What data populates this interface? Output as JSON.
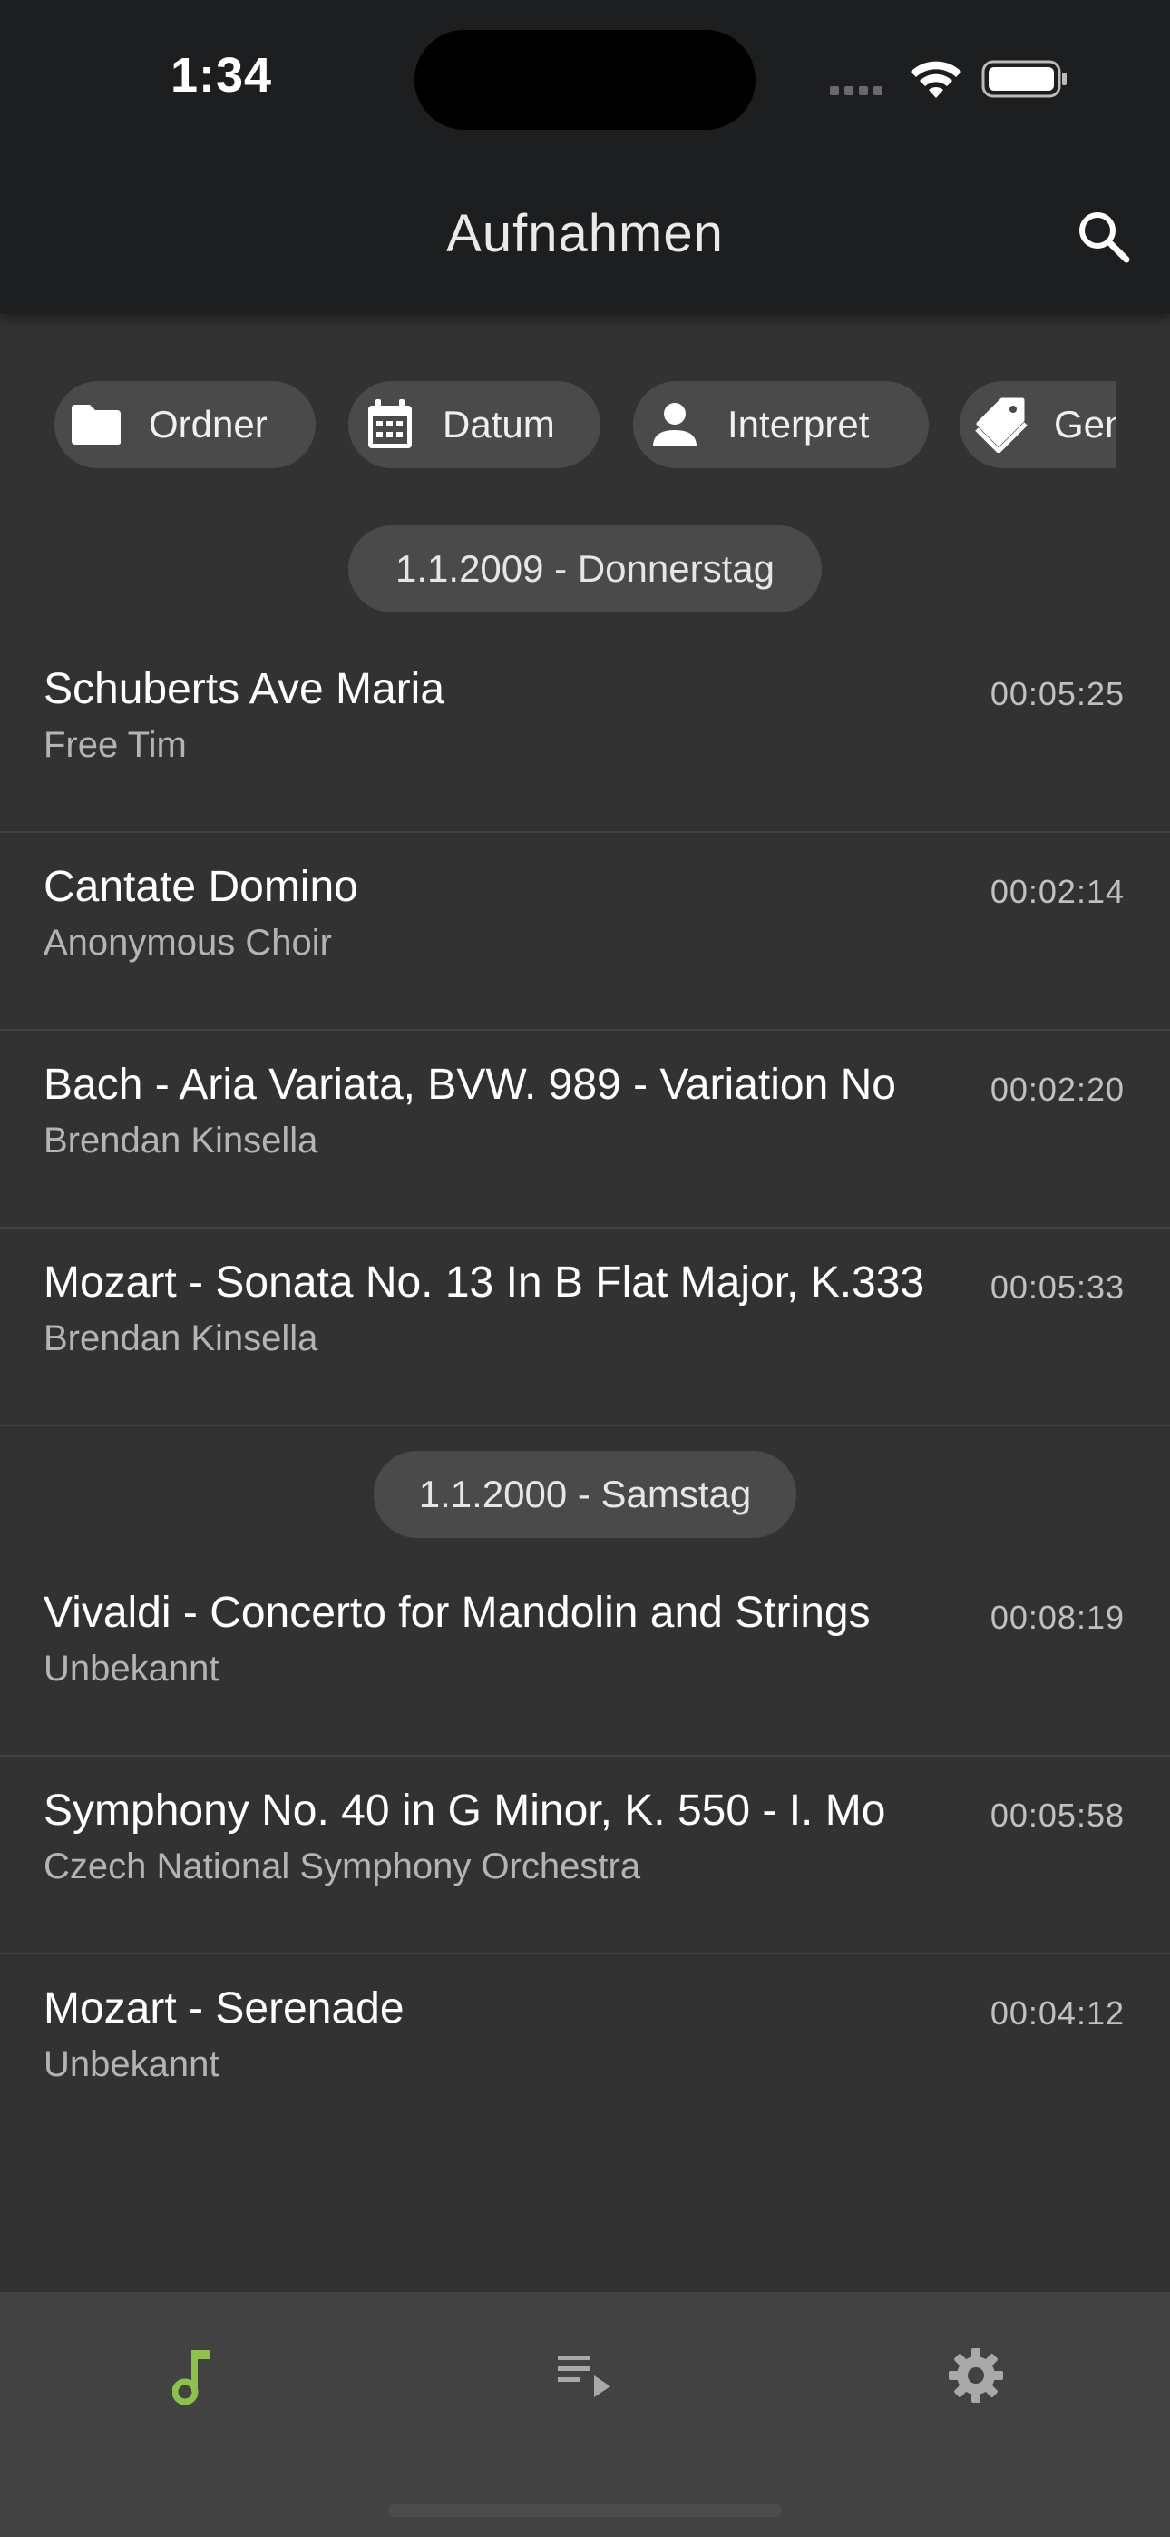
{
  "status_bar": {
    "time": "1:34"
  },
  "app_bar": {
    "title": "Aufnahmen"
  },
  "filters": [
    {
      "label": "Ordner",
      "icon": "folder-icon"
    },
    {
      "label": "Datum",
      "icon": "calendar-icon"
    },
    {
      "label": "Interpret",
      "icon": "person-icon"
    },
    {
      "label": "Genre",
      "icon": "tag-icon"
    }
  ],
  "groups": [
    {
      "date": "1.1.2009 - Donnerstag",
      "tracks": [
        {
          "title": "Schuberts Ave Maria",
          "artist": "Free Tim",
          "duration": "00:05:25"
        },
        {
          "title": "Cantate Domino",
          "artist": "Anonymous Choir",
          "duration": "00:02:14"
        },
        {
          "title": "Bach - Aria Variata, BVW. 989 - Variation No",
          "artist": "Brendan Kinsella",
          "duration": "00:02:20"
        },
        {
          "title": "Mozart - Sonata No. 13 In B Flat Major, K.333",
          "artist": "Brendan Kinsella",
          "duration": "00:05:33"
        }
      ]
    },
    {
      "date": "1.1.2000 - Samstag",
      "tracks": [
        {
          "title": "Vivaldi - Concerto for Mandolin and Strings",
          "artist": "Unbekannt",
          "duration": "00:08:19"
        },
        {
          "title": "Symphony No. 40 in G Minor, K. 550 - I. Mo",
          "artist": "Czech National Symphony Orchestra",
          "duration": "00:05:58"
        },
        {
          "title": "Mozart - Serenade",
          "artist": "Unbekannt",
          "duration": "00:04:12"
        }
      ]
    }
  ],
  "bottom_nav": [
    {
      "name": "recordings",
      "icon": "music-note-icon",
      "active": true
    },
    {
      "name": "playlist",
      "icon": "playlist-play-icon",
      "active": false
    },
    {
      "name": "settings",
      "icon": "gear-icon",
      "active": false
    }
  ],
  "colors": {
    "accent": "#8bc34a",
    "background": "#323233",
    "bar": "#1d1e1f",
    "chip": "#4a4a4b"
  }
}
